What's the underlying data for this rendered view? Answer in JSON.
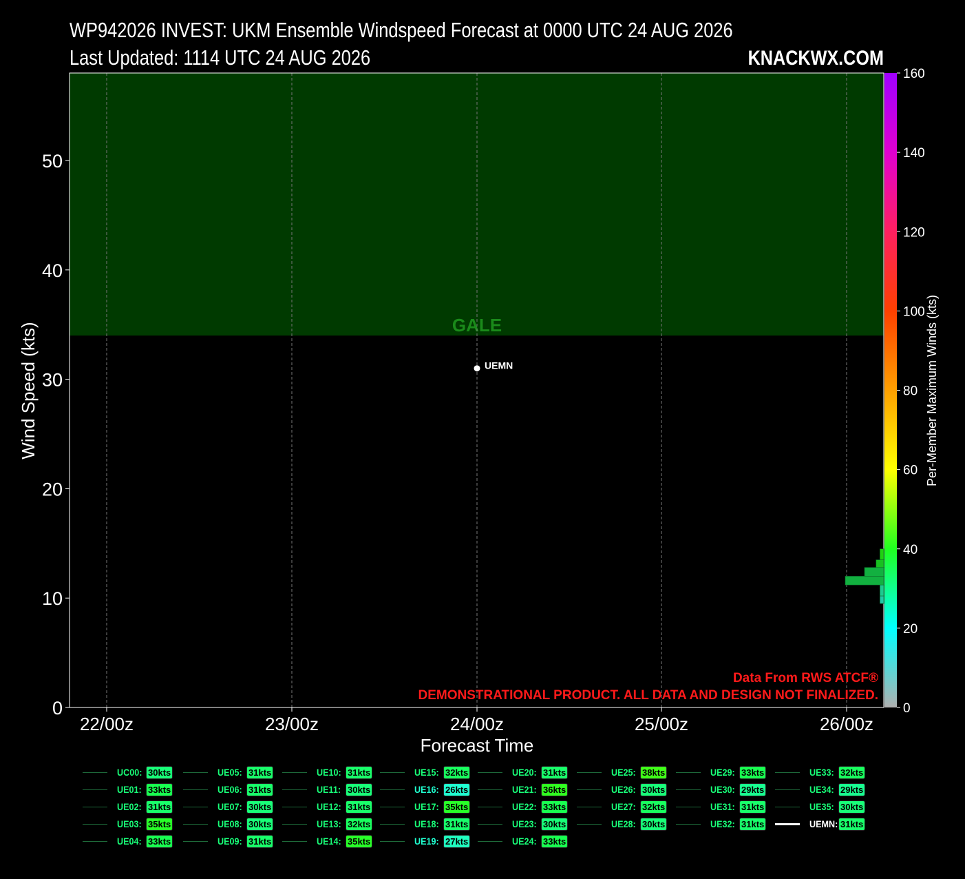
{
  "header": {
    "title": "WP942026 INVEST: UKM Ensemble Windspeed Forecast at 0000 UTC 24 AUG 2026",
    "updated": "Last Updated: 1114 UTC 24 AUG 2026",
    "brand": "KNACKWX.COM"
  },
  "chart_data": {
    "type": "line",
    "title": "WP942026 INVEST: UKM Ensemble Windspeed Forecast at 0000 UTC 24 AUG 2026",
    "xlabel": "Forecast Time",
    "ylabel": "Wind Speed (kts)",
    "x_ticks": [
      "22/00z",
      "23/00z",
      "24/00z",
      "25/00z",
      "26/00z"
    ],
    "y_ticks": [
      0,
      10,
      20,
      30,
      40,
      50
    ],
    "ylim": [
      0,
      58
    ],
    "grid": true,
    "threshold_band": {
      "label": "GALE",
      "from": 34,
      "to": 58,
      "color": "#003a00",
      "label_color": "#1a8a1a"
    },
    "points": [
      {
        "name": "UEMN",
        "x": "24/00z",
        "y": 31
      }
    ],
    "colorbar": {
      "label": "Per-Member Maximum Winds (kts)",
      "ticks": [
        0,
        20,
        40,
        60,
        80,
        100,
        120,
        140,
        160
      ],
      "range": [
        0,
        160
      ]
    },
    "histogram": {
      "bins": [
        {
          "from": 9.5,
          "to": 10.2,
          "count": 1,
          "color": "#22c8a8"
        },
        {
          "from": 10.2,
          "to": 11.2,
          "count": 1,
          "color": "#1ec990"
        },
        {
          "from": 11.2,
          "to": 12.0,
          "count": 10,
          "color": "#12b040"
        },
        {
          "from": 12.0,
          "to": 12.8,
          "count": 5,
          "color": "#12b040"
        },
        {
          "from": 12.8,
          "to": 13.5,
          "count": 2,
          "color": "#18c020"
        },
        {
          "from": 13.5,
          "to": 14.5,
          "count": 1,
          "color": "#20d010"
        }
      ]
    },
    "notes": [
      "Data From RWS ATCF®",
      "DEMONSTRATIONAL PRODUCT. ALL DATA AND DESIGN NOT FINALIZED."
    ]
  },
  "legend": {
    "items": [
      {
        "label": "UC00:",
        "value": "30kts",
        "color": "#18ff78",
        "text_color": "#18ff78"
      },
      {
        "label": "UE01:",
        "value": "33kts",
        "color": "#18ff50",
        "text_color": "#18ff78"
      },
      {
        "label": "UE02:",
        "value": "31kts",
        "color": "#18ff6a",
        "text_color": "#18ff78"
      },
      {
        "label": "UE03:",
        "value": "35kts",
        "color": "#28ff28",
        "text_color": "#18ff78"
      },
      {
        "label": "UE04:",
        "value": "33kts",
        "color": "#18ff50",
        "text_color": "#18ff78"
      },
      {
        "label": "UE05:",
        "value": "31kts",
        "color": "#18ff6a",
        "text_color": "#18ff78"
      },
      {
        "label": "UE06:",
        "value": "31kts",
        "color": "#18ff6a",
        "text_color": "#18ff78"
      },
      {
        "label": "UE07:",
        "value": "30kts",
        "color": "#18ff78",
        "text_color": "#18ff78"
      },
      {
        "label": "UE08:",
        "value": "30kts",
        "color": "#18ff78",
        "text_color": "#18ff78"
      },
      {
        "label": "UE09:",
        "value": "31kts",
        "color": "#18ff6a",
        "text_color": "#18ff78"
      },
      {
        "label": "UE10:",
        "value": "31kts",
        "color": "#18ff6a",
        "text_color": "#18ff78"
      },
      {
        "label": "UE11:",
        "value": "30kts",
        "color": "#18ff78",
        "text_color": "#18ff78"
      },
      {
        "label": "UE12:",
        "value": "31kts",
        "color": "#18ff6a",
        "text_color": "#18ff78"
      },
      {
        "label": "UE13:",
        "value": "32kts",
        "color": "#18ff5e",
        "text_color": "#18ff78"
      },
      {
        "label": "UE14:",
        "value": "35kts",
        "color": "#28ff28",
        "text_color": "#18ff78"
      },
      {
        "label": "UE15:",
        "value": "32kts",
        "color": "#18ff5e",
        "text_color": "#18ff78"
      },
      {
        "label": "UE16:",
        "value": "26kts",
        "color": "#20ffd0",
        "text_color": "#20ffd0"
      },
      {
        "label": "UE17:",
        "value": "35kts",
        "color": "#28ff28",
        "text_color": "#18ff78"
      },
      {
        "label": "UE18:",
        "value": "31kts",
        "color": "#18ff6a",
        "text_color": "#18ff78"
      },
      {
        "label": "UE19:",
        "value": "27kts",
        "color": "#20ffc0",
        "text_color": "#20ffd0"
      },
      {
        "label": "UE20:",
        "value": "31kts",
        "color": "#18ff6a",
        "text_color": "#18ff78"
      },
      {
        "label": "UE21:",
        "value": "36kts",
        "color": "#30ff20",
        "text_color": "#18ff78"
      },
      {
        "label": "UE22:",
        "value": "33kts",
        "color": "#18ff50",
        "text_color": "#18ff78"
      },
      {
        "label": "UE23:",
        "value": "30kts",
        "color": "#18ff78",
        "text_color": "#18ff78"
      },
      {
        "label": "UE24:",
        "value": "33kts",
        "color": "#18ff50",
        "text_color": "#18ff78"
      },
      {
        "label": "UE25:",
        "value": "38kts",
        "color": "#40ff18",
        "text_color": "#18ff78"
      },
      {
        "label": "UE26:",
        "value": "30kts",
        "color": "#18ff78",
        "text_color": "#18ff78"
      },
      {
        "label": "UE27:",
        "value": "32kts",
        "color": "#18ff5e",
        "text_color": "#18ff78"
      },
      {
        "label": "UE28:",
        "value": "30kts",
        "color": "#18ff78",
        "text_color": "#18ff78"
      },
      {
        "label": "UE29:",
        "value": "33kts",
        "color": "#18ff50",
        "text_color": "#18ff78"
      },
      {
        "label": "UE30:",
        "value": "29kts",
        "color": "#18ff90",
        "text_color": "#18ff78"
      },
      {
        "label": "UE31:",
        "value": "31kts",
        "color": "#18ff6a",
        "text_color": "#18ff78"
      },
      {
        "label": "UE32:",
        "value": "31kts",
        "color": "#18ff6a",
        "text_color": "#18ff78"
      },
      {
        "label": "UE33:",
        "value": "32kts",
        "color": "#18ff5e",
        "text_color": "#18ff78"
      },
      {
        "label": "UE34:",
        "value": "29kts",
        "color": "#18ff90",
        "text_color": "#18ff78"
      },
      {
        "label": "UE35:",
        "value": "30kts",
        "color": "#18ff78",
        "text_color": "#18ff78"
      },
      {
        "label": "UEMN:",
        "value": "31kts",
        "color": "#18ff6a",
        "text_color": "#ffffff",
        "mean": true
      }
    ]
  }
}
